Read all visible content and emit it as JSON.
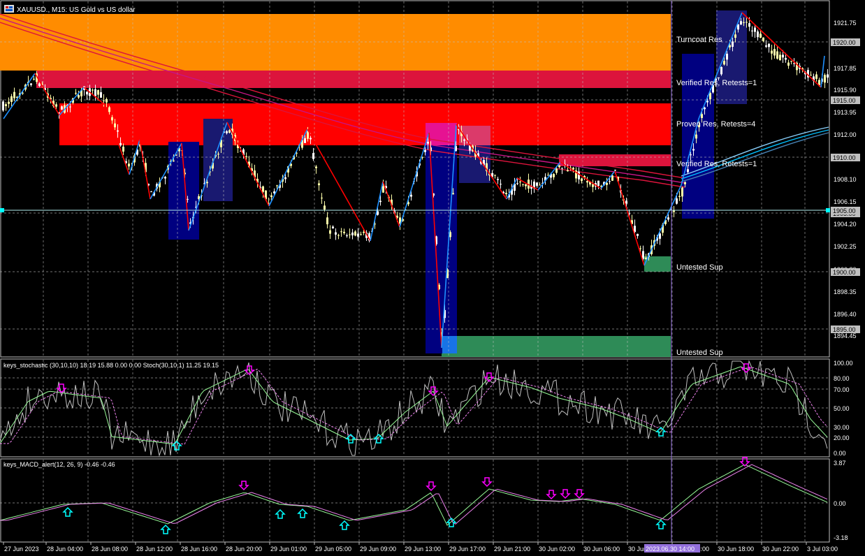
{
  "window": {
    "title": "XAUUSD., M15:  US Gold vs US dollar"
  },
  "main_chart": {
    "price_axis_ticks": [
      "1921.75",
      "1919.55",
      "1917.85",
      "1915.90",
      "1913.95",
      "1912.00",
      "1910.05",
      "1908.10",
      "1906.15",
      "1904.20",
      "1902.25",
      "1900.30",
      "1898.35",
      "1896.40",
      "1894.45"
    ],
    "price_tags": [
      "1920.00",
      "1915.00",
      "1910.00",
      "1905.00",
      "1900.00",
      "1895.00"
    ],
    "current_price_tag": "1905.00",
    "zones": [
      {
        "label": "Turncoat Res",
        "color": "#ff8c00"
      },
      {
        "label": "Verified Res, Retests=1",
        "color": "#dc143c"
      },
      {
        "label": "Proven Res, Retests=4",
        "color": "#ff0000"
      },
      {
        "label": "Verified Res, Retests=1",
        "color": "#dc143c"
      },
      {
        "label": "Untested Sup",
        "color": "#2e8b57"
      },
      {
        "label": "Untested Sup",
        "color": "#2e8b57"
      }
    ]
  },
  "stochastic": {
    "title": "keys_stochastic (30,10,10) 18.19 15.88 0.00 0.00 Stoch(30,10,1) 11.25 19.15",
    "levels": [
      "100.00",
      "80.00",
      "70.00",
      "50.00",
      "30.00",
      "20.00",
      "0.00"
    ]
  },
  "macd": {
    "title": "keys_MACD_alert(12, 26, 9) -0.46 -0.46",
    "levels": [
      "3.87",
      "0.00",
      "-3.18"
    ]
  },
  "time_axis": {
    "labels": [
      "27 Jun 2023",
      "28 Jun 04:00",
      "28 Jun 08:00",
      "28 Jun 12:00",
      "28 Jun 16:00",
      "28 Jun 20:00",
      "29 Jun 01:00",
      "29 Jun 05:00",
      "29 Jun 09:00",
      "29 Jun 13:00",
      "29 Jun 17:00",
      "29 Jun 21:00",
      "30 Jun 02:00",
      "30 Jun 06:00",
      "30 Jun 10:00",
      "30 Jun 14:00",
      "30 Jun 18:00",
      "30 Jun 22:00",
      "3 Jul 03:00"
    ],
    "crosshair_label": "2023.06.30 14:00"
  },
  "colors": {
    "background": "#000000",
    "grid": "#c0c0c0",
    "up_candle": "#ffffaa",
    "down_candle": "#ffffff",
    "zigzag_up": "#1e90ff",
    "zigzag_down": "#ff0000",
    "stoch_main": "#c0c0c0",
    "stoch_signal": "#98fb98",
    "signal_dash": "#ee82ee",
    "arrow_up": "#00ffff",
    "arrow_down": "#ff00ff",
    "crosshair": "#9370db"
  }
}
